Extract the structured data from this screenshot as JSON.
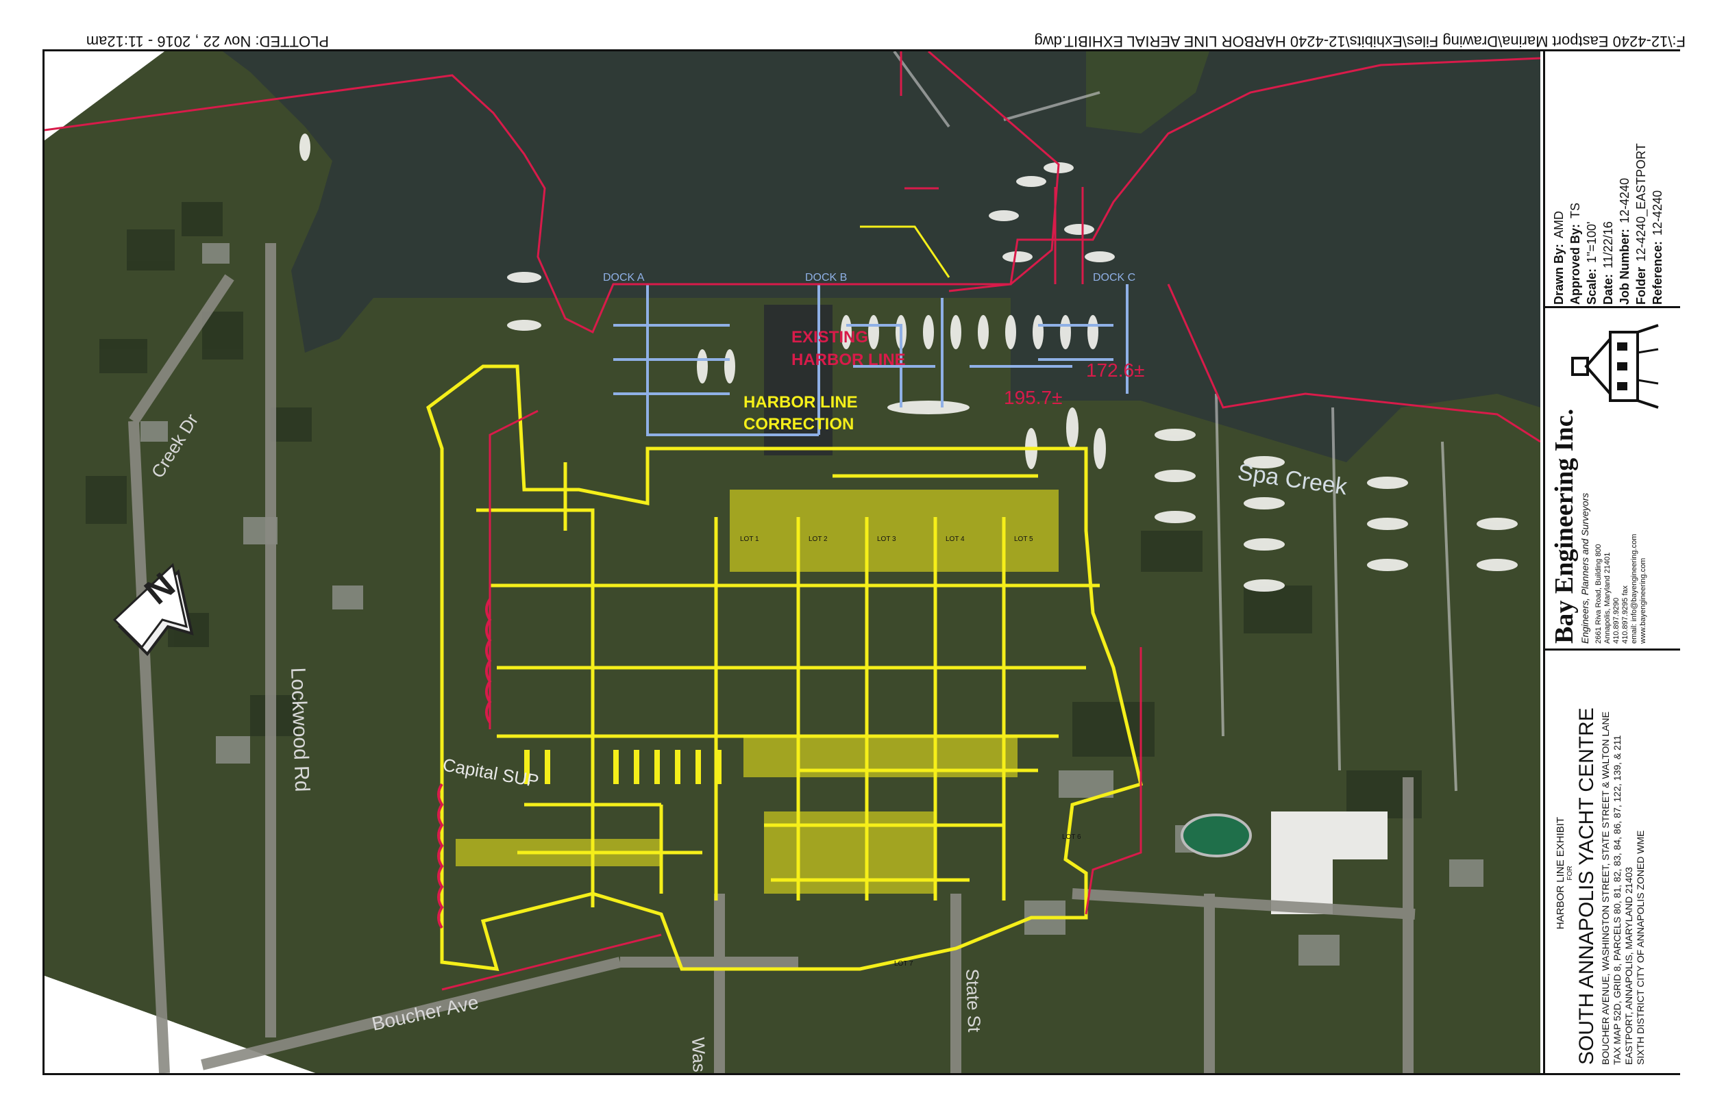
{
  "header": {
    "plotted": "PLOTTED: Nov 22 , 2016 - 11:12am",
    "file_path": "F:\\12-4240 Eastport Marina\\Drawing Files\\Exhibits\\12-4240 HARBOR LINE AERIAL EXHIBIT.dwg"
  },
  "map": {
    "labels": {
      "existing_line_1": "EXISTING",
      "existing_line_2": "HARBOR LINE",
      "correction_1": "HARBOR LINE",
      "correction_2": "CORRECTION",
      "dim_1": "172.6±",
      "dim_2": "195.7±",
      "water": "Spa Creek",
      "creek_dr": "Creek Dr",
      "lockwood": "Lockwood Rd",
      "capital_sup": "Capital SUP",
      "boucher": "Boucher Ave",
      "washington": "Wash",
      "state_st": "State St",
      "dock_a": "DOCK A",
      "dock_b": "DOCK B",
      "dock_c": "DOCK C",
      "north": "N"
    },
    "lots": [
      "LOT 1",
      "LOT 2",
      "LOT 3",
      "LOT 4",
      "LOT 5",
      "LOT 6",
      "LOT 7"
    ],
    "colors": {
      "water": "#2f3a36",
      "land": "#3d4a2c",
      "harbor_line": "#d81b4a",
      "plan": "#f5ef1a",
      "docks": "#8fb0e6"
    }
  },
  "title_block": {
    "drawn_by_label": "Drawn By:",
    "drawn_by": "AMD",
    "approved_by_label": "Approved By:",
    "approved_by": "TS",
    "scale_label": "Scale:",
    "scale": "1\"=100'",
    "date_label": "Date:",
    "date": "11/22/16",
    "job_label": "Job Number:",
    "job": "12-4240",
    "folder_label": "Folder",
    "folder": "12-4240_EASTPORT",
    "reference_label": "Reference:",
    "reference": "12-4240",
    "company": "Bay Engineering Inc.",
    "tagline": "Engineers, Planners and Surveyors",
    "address_1": "2661 Riva Road, Building 800",
    "address_2": "Annapolis, Maryland 21401",
    "phone": "410.897.9290",
    "fax": "410.897.9295 fax",
    "email": "email: info@bayengineering.com",
    "web": "www.bayengineering.com",
    "exhibit": "HARBOR LINE EXHIBIT",
    "for": "FOR",
    "project": "SOUTH ANNAPOLIS YACHT CENTRE",
    "line_1": "BOUCHER AVENUE, WASHINGTON STREET, STATE STREET & WALTON LANE",
    "line_2": "TAX MAP 52D, GRID 8, PARCELS 80, 81, 82, 83, 84, 86, 87, 122, 139, & 211",
    "line_3": "EASTPORT, ANNAPOLIS, MARYLAND 21403",
    "line_4": "SIXTH DISTRICT     CITY OF ANNAPOLIS     ZONED WME"
  }
}
